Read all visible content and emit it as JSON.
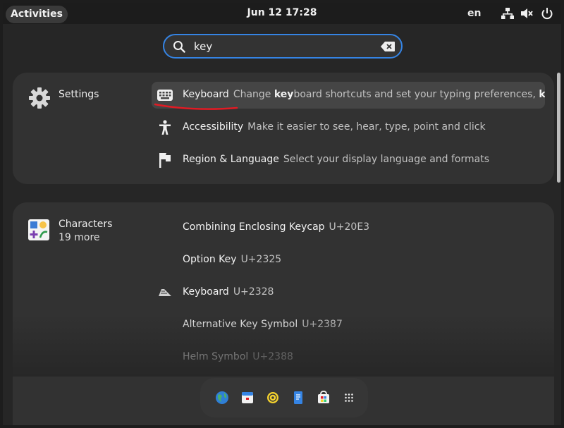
{
  "topbar": {
    "activities_label": "Activities",
    "datetime": "Jun 12  17:28",
    "language": "en",
    "tray_icons": [
      "network-icon",
      "volume-muted-icon",
      "power-icon"
    ]
  },
  "search": {
    "value": "key",
    "icon": "search-icon",
    "clear_icon": "clear-icon"
  },
  "settings_provider": {
    "name": "Settings",
    "icon": "gear-icon",
    "results": [
      {
        "title": "Keyboard",
        "desc_pre": "Change ",
        "desc_bold": "key",
        "desc_post": "board shortcuts and set your typing preferences, ",
        "desc_tail_bold": "keyb",
        "ellipsis": "…",
        "icon": "keyboard-icon",
        "selected": true
      },
      {
        "title": "Accessibility",
        "desc": "Make it easier to see, hear, type, point and click",
        "icon": "accessibility-icon"
      },
      {
        "title": "Region & Language",
        "desc": "Select your display language and formats",
        "icon": "flag-icon"
      }
    ]
  },
  "characters_provider": {
    "name": "Characters",
    "more": "19 more",
    "icon": "characters-app-icon",
    "results": [
      {
        "title": "Combining Enclosing Keycap",
        "desc": "U+20E3"
      },
      {
        "title": "Option Key",
        "desc": "U+2325"
      },
      {
        "title": "Keyboard",
        "desc": "U+2328",
        "icon": "keyboard-glyph-icon"
      },
      {
        "title": "Alternative Key Symbol",
        "desc": "U+2387"
      },
      {
        "title": "Helm Symbol",
        "desc": "U+2388"
      }
    ]
  },
  "dock": {
    "items": [
      "browser-icon",
      "calendar-icon",
      "rhythmbox-icon",
      "text-editor-icon",
      "software-center-icon",
      "app-grid-icon"
    ]
  },
  "colors": {
    "accent": "#3584e4",
    "annotation": "#e01b24"
  }
}
